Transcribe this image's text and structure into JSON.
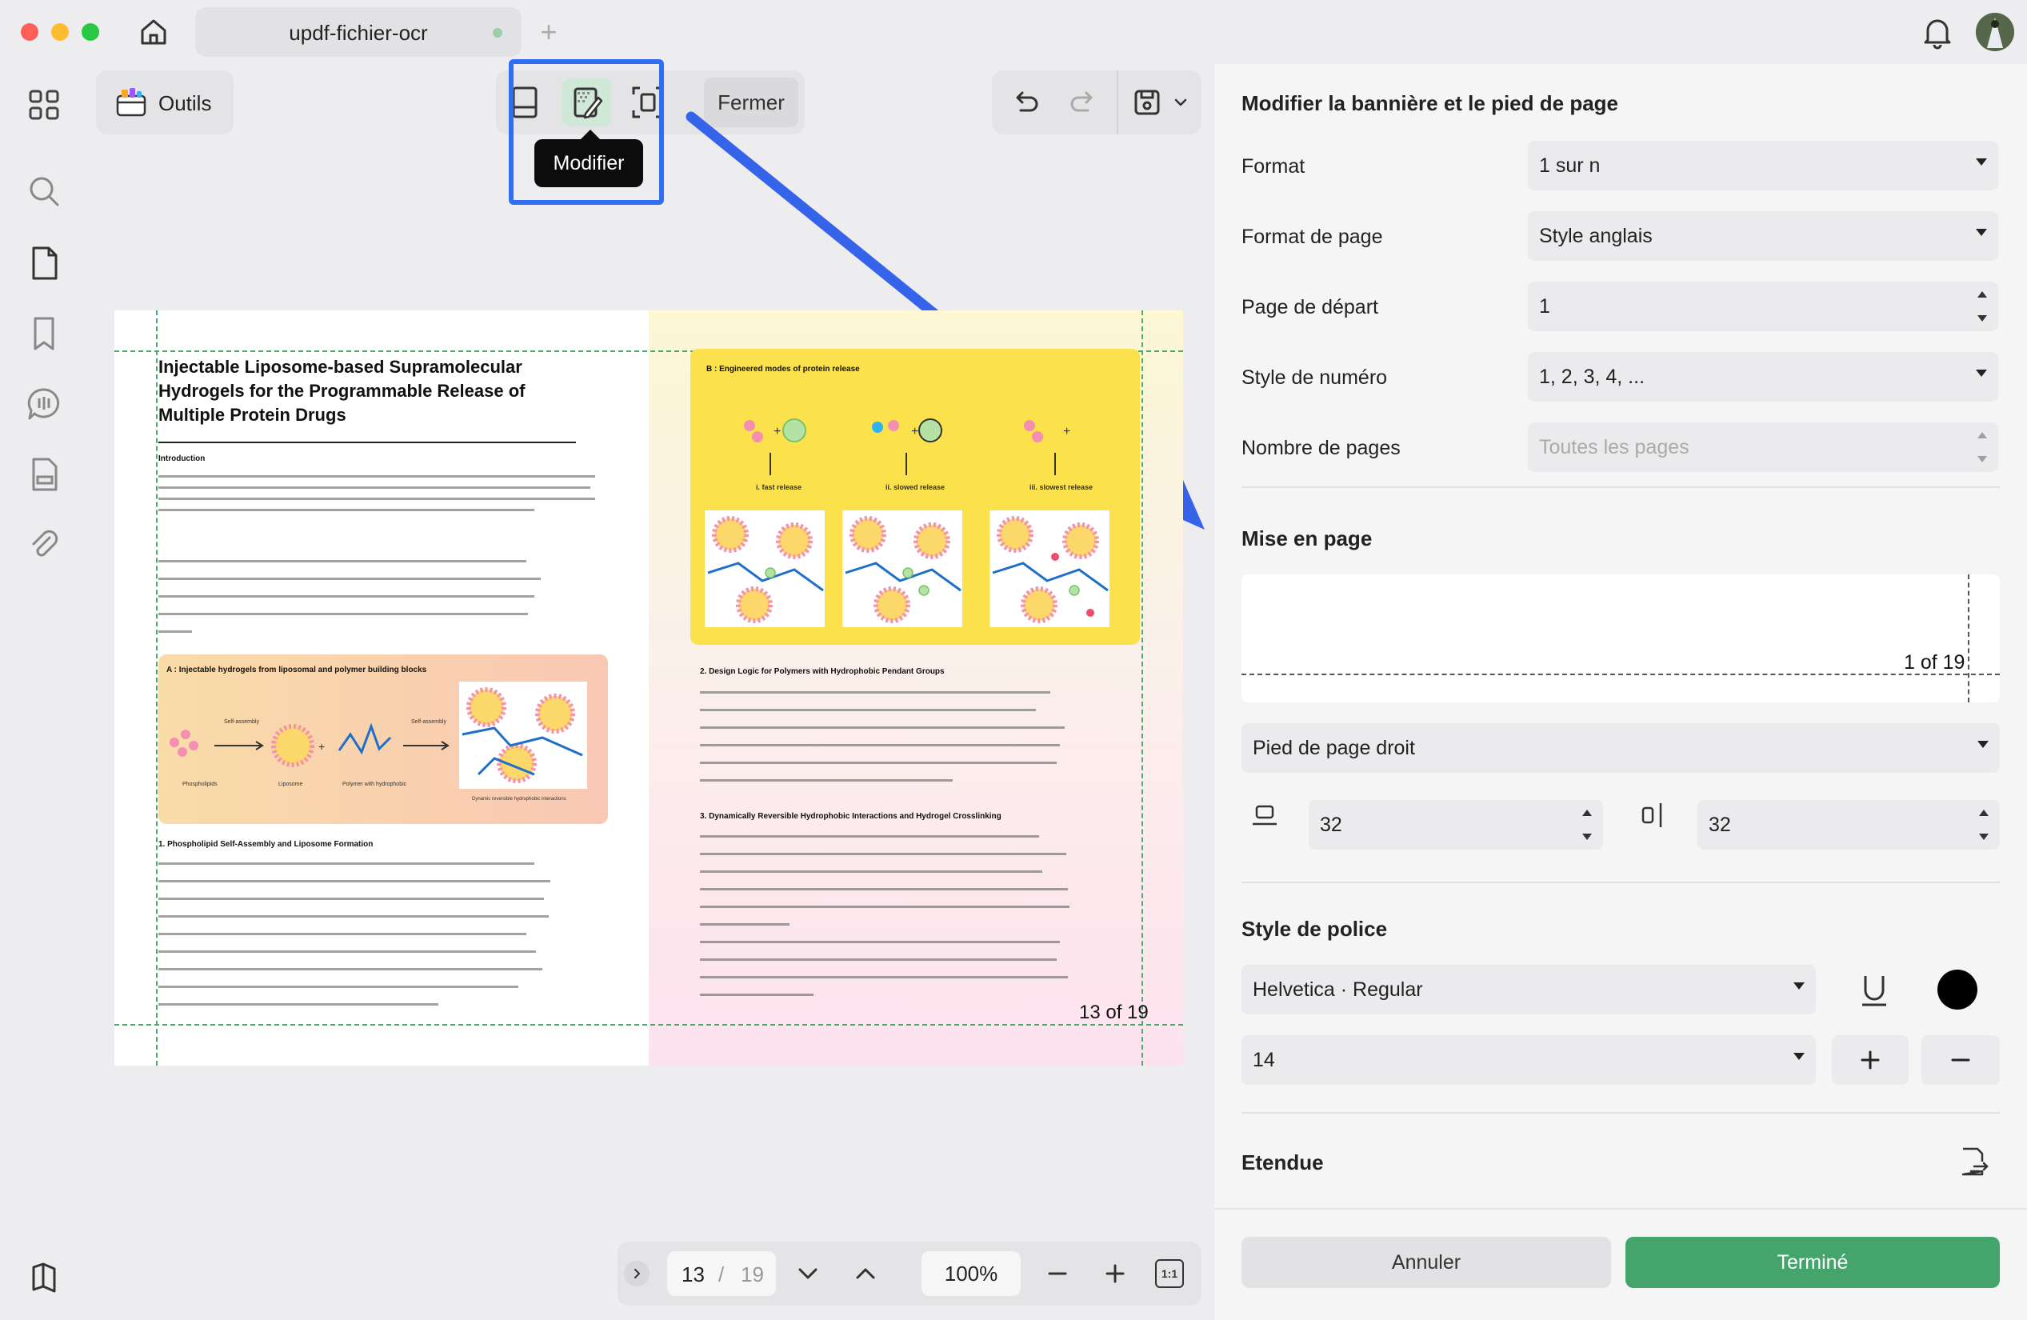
{
  "window": {
    "tab_title": "updf-fichier-ocr"
  },
  "toolbar": {
    "tools_label": "Outils",
    "close_label": "Fermer",
    "tooltip": "Modifier"
  },
  "document": {
    "title_line1": "Injectable Liposome-based Supramolecular",
    "title_line2": "Hydrogels for the Programmable Release of",
    "title_line3": "Multiple Protein Drugs",
    "intro_heading": "Introduction",
    "figA_title": "A : Injectable hydrogels from liposomal and polymer building blocks",
    "figB_title": "B : Engineered modes of protein release",
    "fig_fast": "i. fast release",
    "fig_slowed": "ii. slowed release",
    "fig_slowest": "iii. slowest release",
    "sec1_heading": "1. Phospholipid Self-Assembly and Liposome Formation",
    "sec2_heading": "2. Design Logic for Polymers with Hydrophobic Pendant Groups",
    "sec3_heading": "3. Dynamically Reversible Hydrophobic Interactions and Hydrogel Crosslinking",
    "page_footer": "13 of 19"
  },
  "pager": {
    "current_page": "13",
    "separator": "/",
    "total_pages": "19",
    "zoom": "100%",
    "fit_label": "1:1"
  },
  "panel": {
    "title": "Modifier la bannière et le pied de page",
    "format_label": "Format",
    "format_value": "1 sur n",
    "page_format_label": "Format de page",
    "page_format_value": "Style anglais",
    "start_page_label": "Page de départ",
    "start_page_value": "1",
    "number_style_label": "Style de numéro",
    "number_style_value": "1, 2, 3, 4, ...",
    "page_count_label": "Nombre de pages",
    "page_count_placeholder": "Toutes les pages",
    "layout_heading": "Mise en page",
    "preview_text": "1 of 19",
    "position_value": "Pied de page droit",
    "margin_bottom": "32",
    "margin_right": "32",
    "font_heading": "Style de police",
    "font_value": "Helvetica · Regular",
    "font_size": "14",
    "text_color": "#000000",
    "range_heading": "Etendue",
    "cancel_label": "Annuler",
    "done_label": "Terminé"
  },
  "colors": {
    "accent": "#2f6df2",
    "done_button": "#44a46b",
    "figure_yellow": "#fbe24c",
    "figure_peach": "#f9cfa4"
  },
  "icons": [
    "home-icon",
    "grid-icon",
    "search-icon",
    "page-icon",
    "bookmark-icon",
    "comment-icon",
    "form-icon",
    "attachment-icon",
    "layers-icon",
    "bell-icon",
    "undo-icon",
    "redo-icon",
    "save-icon",
    "underline-icon",
    "plus-icon",
    "minus-icon"
  ]
}
